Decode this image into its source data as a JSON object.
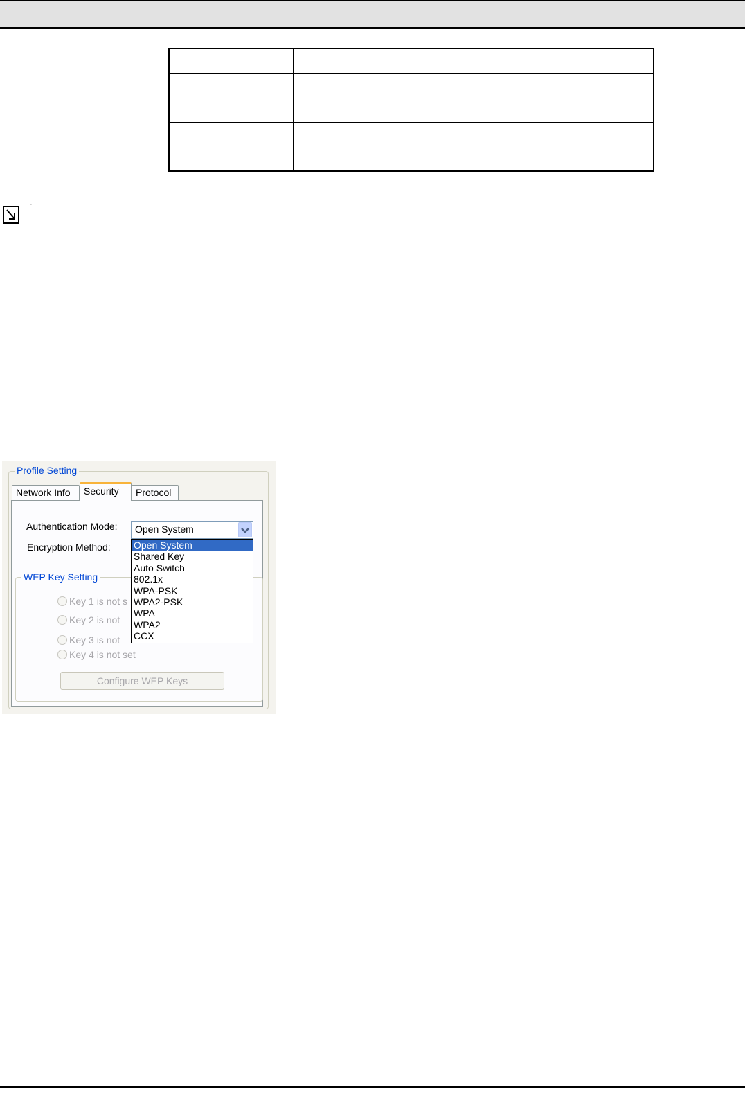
{
  "table": {
    "rows": [
      [
        "",
        ""
      ],
      [
        "",
        ""
      ],
      [
        "",
        ""
      ]
    ]
  },
  "panel": {
    "group_title": "Profile Setting",
    "tabs": [
      {
        "label": "Network Info",
        "active": false
      },
      {
        "label": "Security",
        "active": true
      },
      {
        "label": "Protocol",
        "active": false
      }
    ],
    "auth_label": "Authentication Mode:",
    "enc_label": "Encryption Method:",
    "auth_value": "Open System",
    "auth_options": [
      "Open System",
      "Shared Key",
      "Auto Switch",
      "802.1x",
      "WPA-PSK",
      "WPA2-PSK",
      "WPA",
      "WPA2",
      "CCX"
    ],
    "selected_option": "Open System",
    "wep_group_title": "WEP Key Setting",
    "keys": [
      "Key 1 is not s",
      "Key 2 is not",
      "Key 3 is not",
      "Key 4 is not set"
    ],
    "configure_button": "Configure WEP Keys"
  },
  "colors": {
    "group_title": "#0046d5",
    "selection": "#316ac5",
    "active_tab_accent": "#f8b33a",
    "header_bar": "#e2e2e2"
  },
  "icons": {
    "note": "arrow-down-right-box-icon",
    "combo": "chevron-down-icon"
  }
}
